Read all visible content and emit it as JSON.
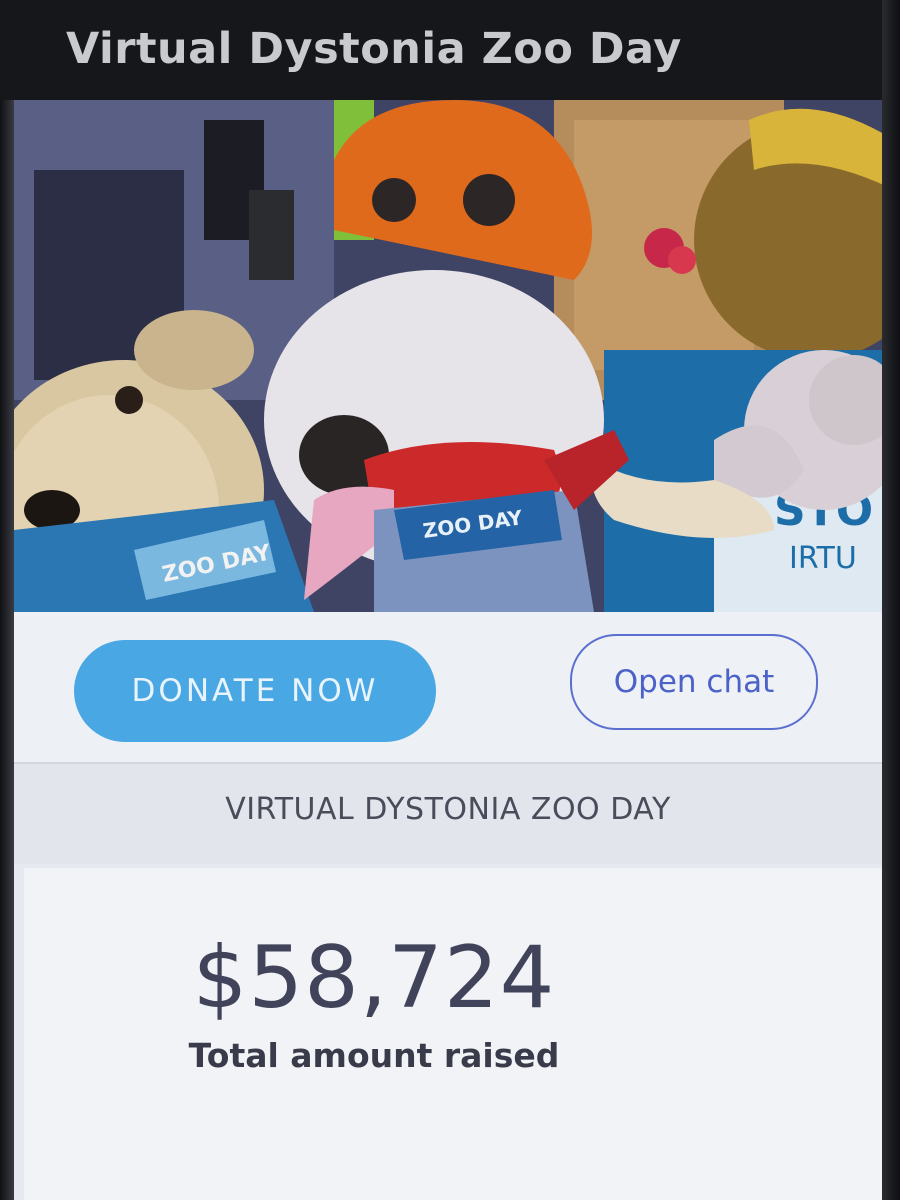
{
  "header": {
    "title": "Virtual Dystonia Zoo Day"
  },
  "media": {
    "shirt_text": "ZOO DAY",
    "banner_letters": "STO",
    "banner_word": "IRTU"
  },
  "actions": {
    "donate_label": "DONATE NOW",
    "chat_label": "Open chat"
  },
  "campaign": {
    "name": "VIRTUAL DYSTONIA ZOO DAY"
  },
  "stats": {
    "amount": "$58,724",
    "amount_label": "Total amount raised"
  },
  "colors": {
    "accent": "#49a7e4",
    "chat_border": "#5a6fd0",
    "header_bg": "#16171a"
  }
}
